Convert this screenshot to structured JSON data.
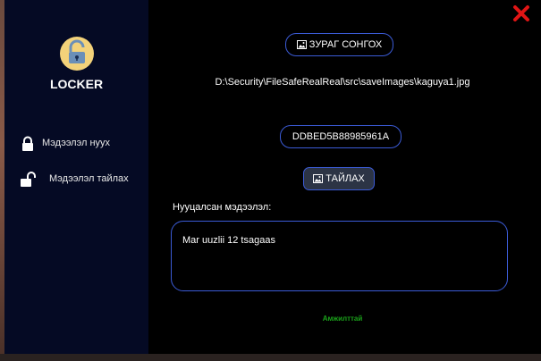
{
  "app": {
    "name": "LOCKER"
  },
  "sidebar": {
    "items": [
      {
        "label": "Мэдээлэл нуух",
        "icon": "lock-icon"
      },
      {
        "label": "Мэдээлэл тайлах",
        "icon": "unlock-icon"
      }
    ]
  },
  "main": {
    "select_image_label": "ЗУРАГ СОНГОХ",
    "image_path": "D:\\Security\\FileSafeRealReal\\src\\saveImages\\kaguya1.jpg",
    "key_value": "DDBED5B88985961A",
    "decrypt_label": "ТАЙЛАХ",
    "hidden_info_caption": "Нууцалсан мэдээлэл:",
    "hidden_info_value": "Mar uuzlii 12 tsagaas",
    "status_text": "Амжилттай"
  },
  "colors": {
    "sidebar_bg": "#050a24",
    "main_bg": "#000000",
    "accent_border": "#3b5bd6",
    "success": "#1aa11a",
    "close": "#e01515"
  }
}
